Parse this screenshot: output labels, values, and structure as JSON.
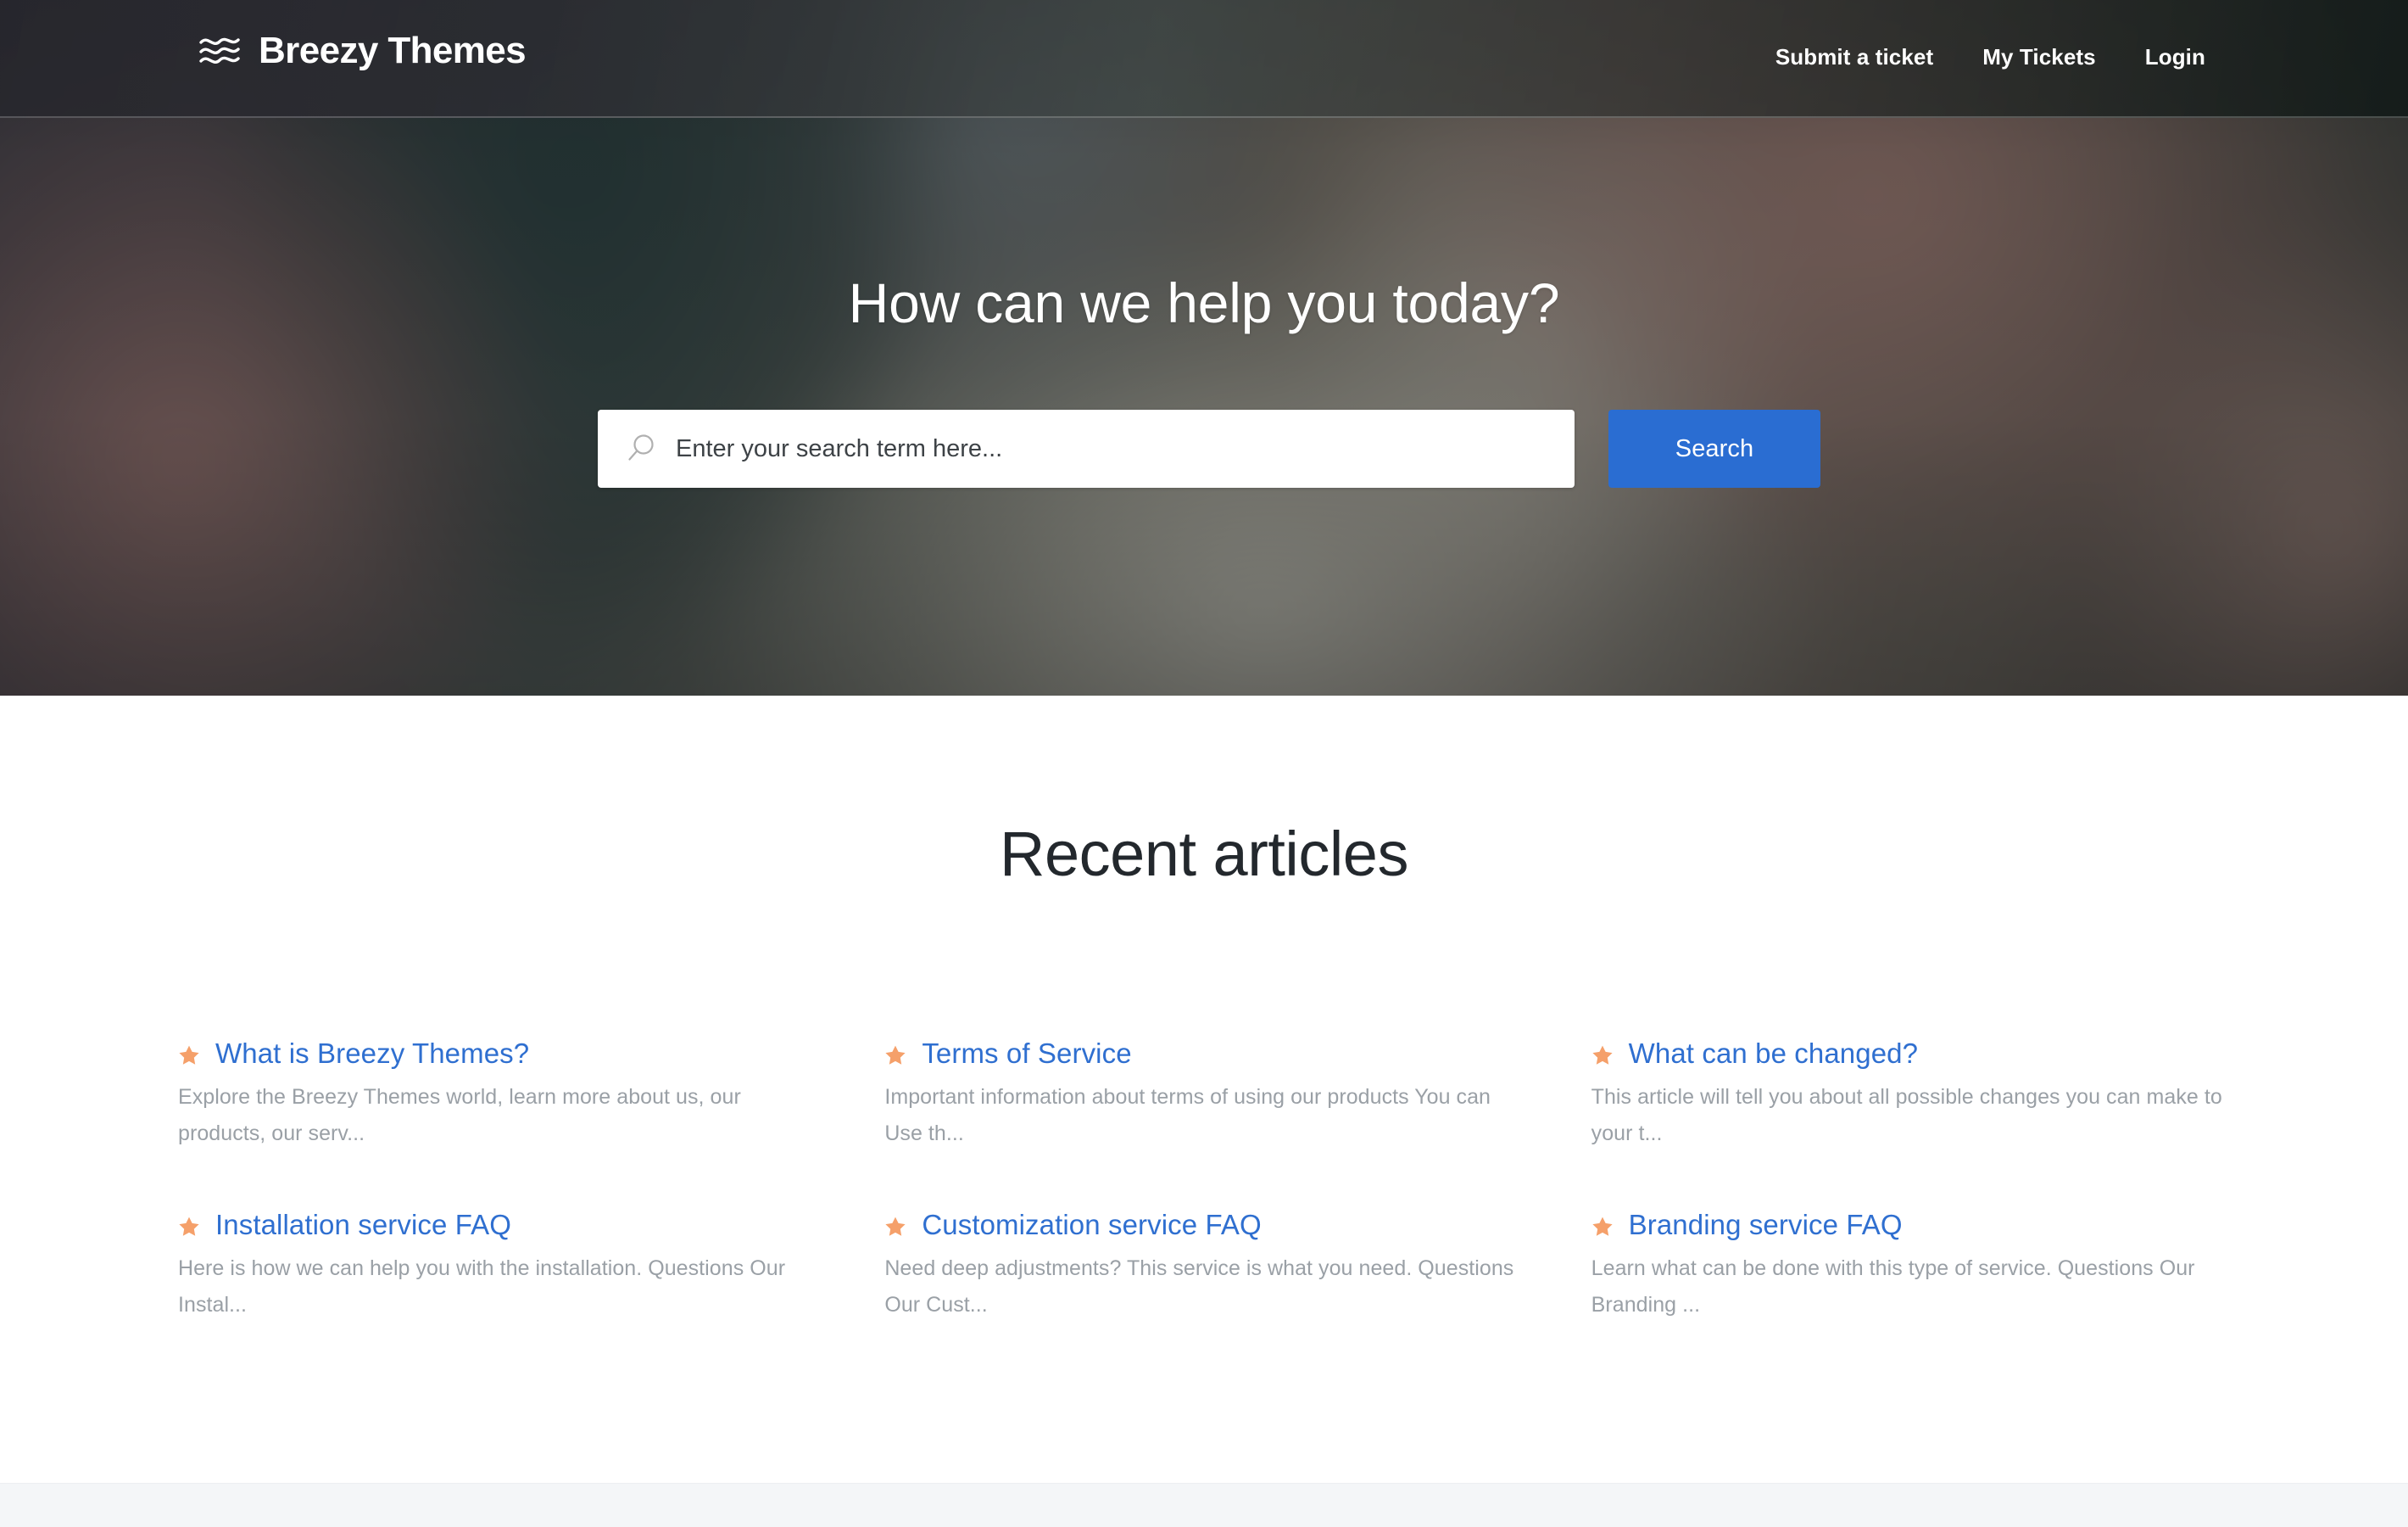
{
  "header": {
    "logo": {
      "icon": "waves-icon",
      "text": "Breezy Themes"
    },
    "nav": [
      {
        "label": "Submit a ticket"
      },
      {
        "label": "My Tickets"
      },
      {
        "label": "Login"
      }
    ]
  },
  "hero": {
    "title": "How can we help you today?",
    "search": {
      "icon": "search-icon",
      "placeholder": "Enter your search term here...",
      "value": "",
      "button_label": "Search"
    }
  },
  "main": {
    "section_title": "Recent articles",
    "articles": [
      {
        "icon": "star-icon",
        "title": "What is Breezy Themes?",
        "description": "Explore the Breezy Themes world, learn more about us, our products, our serv..."
      },
      {
        "icon": "star-icon",
        "title": "Terms of Service",
        "description": "Important information about terms of using our products You can Use th..."
      },
      {
        "icon": "star-icon",
        "title": "What can be changed?",
        "description": "This article will tell you about all possible changes you can make to your t..."
      },
      {
        "icon": "star-icon",
        "title": "Installation service FAQ",
        "description": "Here is how we can help you with the installation. Questions Our Instal..."
      },
      {
        "icon": "star-icon",
        "title": "Customization service FAQ",
        "description": "Need deep adjustments? This service is what you need. Questions Our Cust..."
      },
      {
        "icon": "star-icon",
        "title": "Branding service FAQ",
        "description": "Learn what can be done with this type of service. Questions Our Branding ..."
      }
    ]
  },
  "colors": {
    "accent_blue": "#2a6dd2",
    "link_blue": "#2f6fd0",
    "star_orange": "#f5a06a",
    "heading_dark": "#23282d",
    "body_gray": "#9aa0a6",
    "footer_gray": "#f4f6f8",
    "header_white": "#ffffff"
  }
}
